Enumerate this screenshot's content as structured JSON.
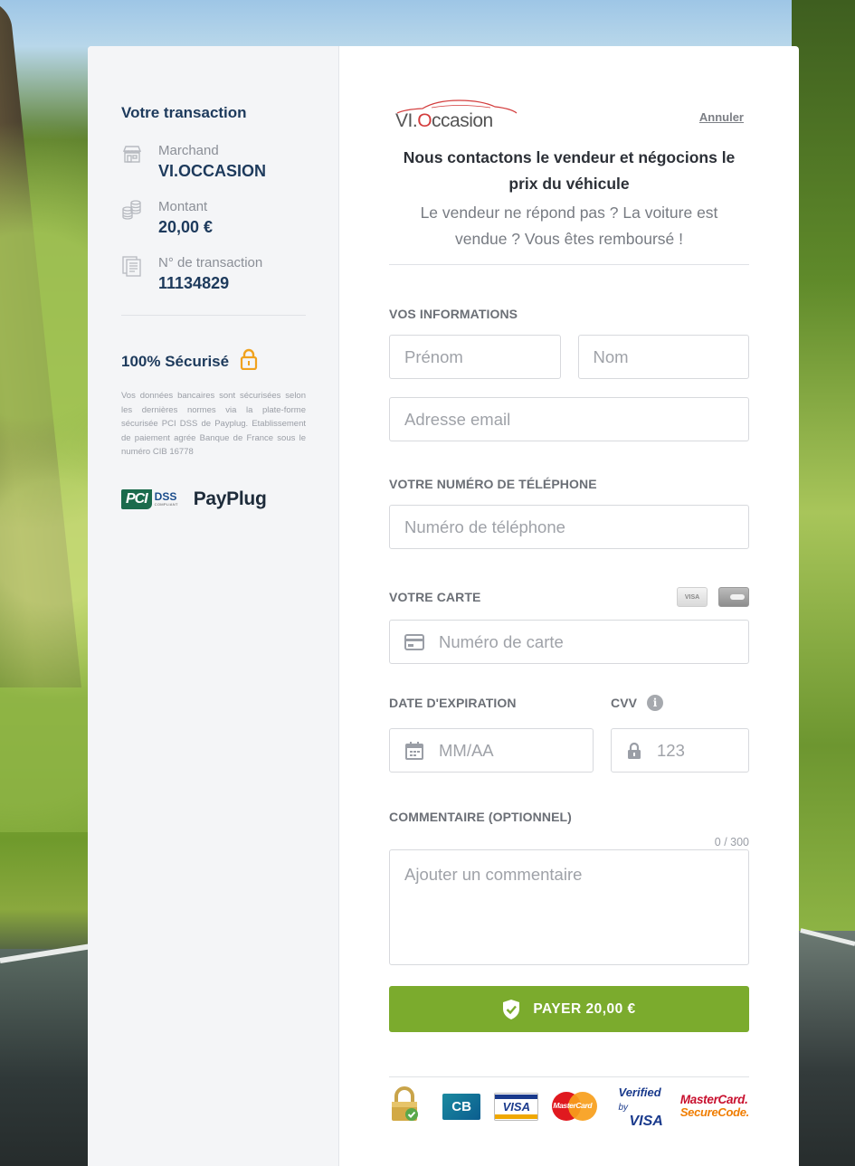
{
  "summary": {
    "title": "Votre transaction",
    "merchant": {
      "label": "Marchand",
      "value": "VI.OCCASION",
      "icon": "store-icon"
    },
    "amount": {
      "label": "Montant",
      "value": "20,00 €",
      "icon": "coins-icon"
    },
    "transaction": {
      "label": "N° de transaction",
      "value": "11134829",
      "icon": "receipt-icon"
    }
  },
  "security": {
    "title": "100% Sécurisé",
    "text": "Vos données bancaires sont sécurisées selon les dernières normes via la plate-forme sécurisée PCI DSS de Payplug. Etablissement de paiement agrée Banque de France sous le numéro CIB 16778",
    "pci_logo": {
      "mark": "PCI",
      "dss": "DSS",
      "sub": "COMPLIANT"
    },
    "provider": "PayPlug"
  },
  "header": {
    "logo_prefix": "VI.",
    "logo_o": "O",
    "logo_suffix": "ccasion",
    "cancel": "Annuler"
  },
  "pitch": {
    "headline": "Nous contactons le vendeur et négocions le prix du véhicule",
    "sub": "Le vendeur ne répond pas ? La voiture est vendue ? Vous êtes remboursé !"
  },
  "form": {
    "info_label": "VOS INFORMATIONS",
    "first_name_placeholder": "Prénom",
    "last_name_placeholder": "Nom",
    "email_placeholder": "Adresse email",
    "phone_label": "VOTRE NUMÉRO DE TÉLÉPHONE",
    "phone_placeholder": "Numéro de téléphone",
    "card_label": "VOTRE CARTE",
    "card_brands": [
      "VISA",
      "MasterCard"
    ],
    "card_placeholder": "Numéro de carte",
    "expiry_label": "DATE D'EXPIRATION",
    "expiry_placeholder": "MM/AA",
    "cvv_label": "CVV",
    "cvv_placeholder": "123",
    "comment_label": "COMMENTAIRE (OPTIONNEL)",
    "comment_counter": "0 / 300",
    "comment_placeholder": "Ajouter un commentaire",
    "pay_button": "PAYER 20,00 €"
  },
  "footer": {
    "cb": "CB",
    "visa": "VISA",
    "mastercard": "MasterCard",
    "verified_by": "Verified",
    "verified_by_small": "by",
    "verified_visa": "VISA",
    "mc_securecode_top": "MasterCard.",
    "mc_securecode_bottom": "SecureCode."
  },
  "colors": {
    "accent_navy": "#1d3a5c",
    "pay_green": "#7bab2d",
    "lock_orange": "#f0a21e",
    "logo_red": "#d33c3c"
  }
}
